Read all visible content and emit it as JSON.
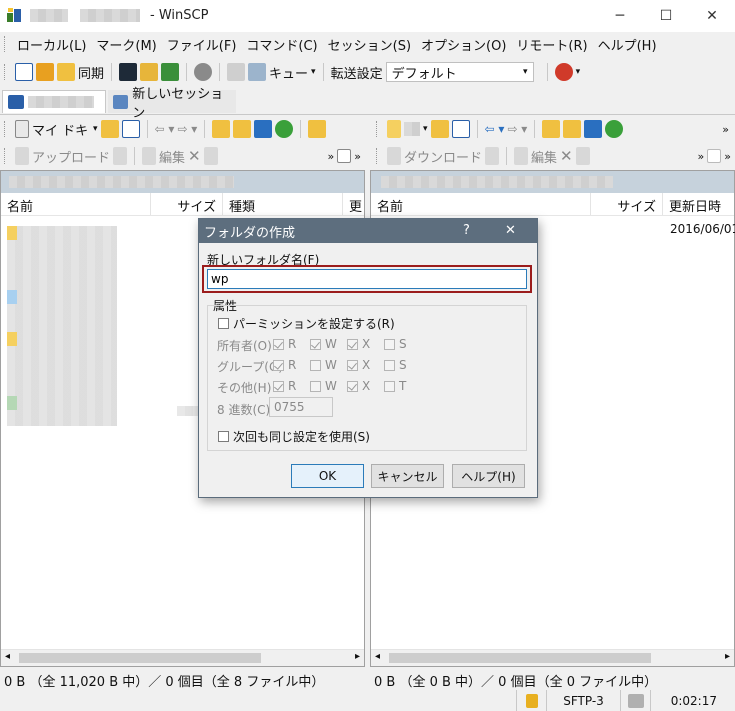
{
  "window": {
    "title": "- WinSCP",
    "minimize": "─",
    "maximize": "☐",
    "close": "✕"
  },
  "menu": [
    "ローカル(L)",
    "マーク(M)",
    "ファイル(F)",
    "コマンド(C)",
    "セッション(S)",
    "オプション(O)",
    "リモート(R)",
    "ヘルプ(H)"
  ],
  "toolbar": {
    "sync_label": "同期",
    "queue_label": "キュー",
    "transfer_label": "転送設定",
    "transfer_value": "デフォルト"
  },
  "tabs": {
    "new_session": "新しいセッション"
  },
  "local": {
    "location": "マイ ドキュ",
    "upload": "アップロード",
    "edit": "編集",
    "columns": [
      "名前",
      "サイズ",
      "種類",
      "更"
    ],
    "status": "0 B （全 11,020 B 中）／ 0 個目（全 8 ファイル中）"
  },
  "remote": {
    "download": "ダウンロード",
    "edit": "編集",
    "columns": [
      "名前",
      "サイズ",
      "更新日時"
    ],
    "first_date": "2016/06/01",
    "status": "0 B （全 0 B 中）／ 0 個目（全 0 ファイル中）"
  },
  "statusbar": {
    "protocol": "SFTP-3",
    "elapsed": "0:02:17"
  },
  "dialog": {
    "title": "フォルダの作成",
    "help_glyph": "?",
    "close_glyph": "✕",
    "name_label": "新しいフォルダ名(F)",
    "name_value": "wp",
    "attributes_label": "属性",
    "set_permissions": "パーミッションを設定する(R)",
    "rows": [
      {
        "label": "所有者(O)",
        "perms": [
          "R",
          "W",
          "X",
          "S"
        ]
      },
      {
        "label": "グループ(G)",
        "perms": [
          "R",
          "W",
          "X",
          "S"
        ]
      },
      {
        "label": "その他(H)",
        "perms": [
          "R",
          "W",
          "X",
          "T"
        ]
      }
    ],
    "octal_label": "8 進数(C)",
    "octal_value": "0755",
    "reuse_label": "次回も同じ設定を使用(S)",
    "ok": "OK",
    "cancel": "キャンセル",
    "help": "ヘルプ(H)"
  },
  "colors": {
    "dialog_title_bg": "#5d6e7e",
    "path_bar": "#c6d2dc",
    "highlight_border": "#9b1c1c",
    "input_border": "#2b7bb9"
  }
}
